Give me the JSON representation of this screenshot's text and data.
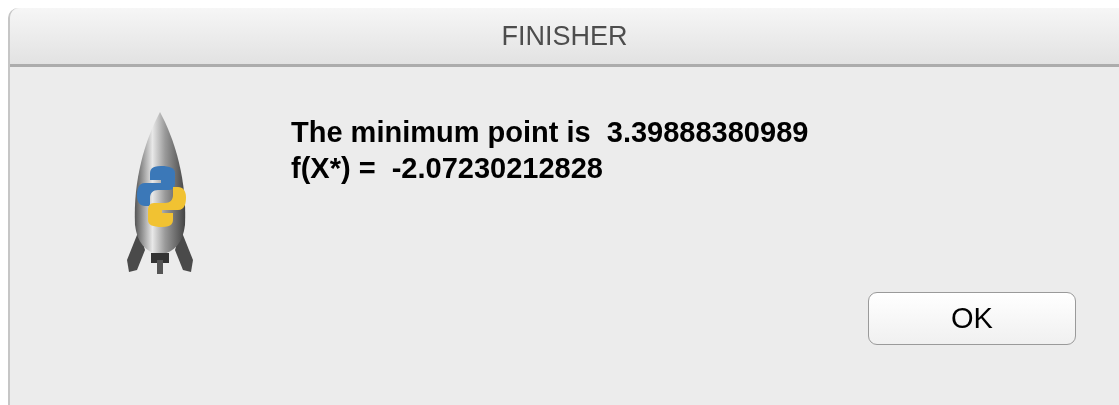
{
  "window": {
    "title": "FINISHER"
  },
  "message": {
    "lines": [
      "The minimum point is  3.39888380989",
      "f(X*) =  -2.07230212828"
    ]
  },
  "buttons": [
    {
      "label": "OK",
      "kind": "default"
    }
  ]
}
